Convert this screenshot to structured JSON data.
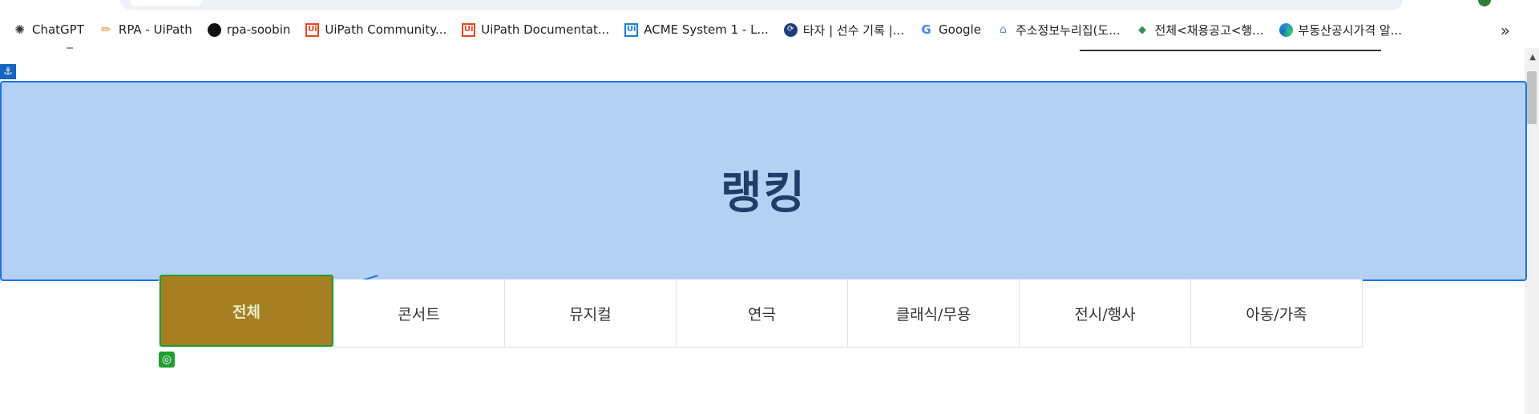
{
  "bookmarks": [
    {
      "label": "ChatGPT",
      "icon": "chatgpt-icon",
      "glyph": "✺"
    },
    {
      "label": "RPA - UiPath",
      "icon": "pencil-icon",
      "glyph": "✏"
    },
    {
      "label": "rpa-soobin",
      "icon": "github-icon",
      "glyph": "●"
    },
    {
      "label": "UiPath Community...",
      "icon": "uipath-icon",
      "glyph": "Ui"
    },
    {
      "label": "UiPath Documentat...",
      "icon": "uipath-icon",
      "glyph": "Ui"
    },
    {
      "label": "ACME System 1 - L...",
      "icon": "uipath-blue-icon",
      "glyph": "Ui"
    },
    {
      "label": "타자 | 선수 기록 |...",
      "icon": "tazza-icon",
      "glyph": "⟳"
    },
    {
      "label": "Google",
      "icon": "google-icon",
      "glyph": "G"
    },
    {
      "label": "주소정보누리집(도...",
      "icon": "house-icon",
      "glyph": "⌂"
    },
    {
      "label": "전체<채용공고<행...",
      "icon": "bird-icon",
      "glyph": "◆"
    },
    {
      "label": "부동산공시가격 알...",
      "icon": "edge-icon",
      "glyph": ""
    }
  ],
  "bookmarks_more": "»",
  "anchor_glyph": "⚓",
  "banner": {
    "title": "랭킹"
  },
  "tabs": [
    {
      "label": "전체",
      "active": true
    },
    {
      "label": "콘서트",
      "active": false
    },
    {
      "label": "뮤지컬",
      "active": false
    },
    {
      "label": "연극",
      "active": false
    },
    {
      "label": "클래식/무용",
      "active": false
    },
    {
      "label": "전시/행사",
      "active": false
    },
    {
      "label": "아동/가족",
      "active": false
    }
  ],
  "target_glyph": "◎",
  "colors": {
    "banner_bg": "#b4d1f4",
    "banner_border": "#1a73e8",
    "active_tab_bg": "#a67f22",
    "active_tab_border": "#1f9d2f"
  }
}
